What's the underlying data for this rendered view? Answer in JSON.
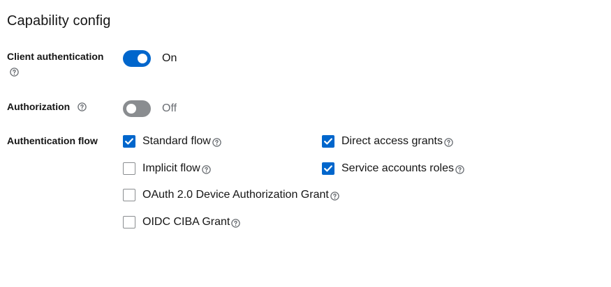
{
  "section": {
    "title": "Capability config"
  },
  "client_authentication": {
    "label": "Client authentication",
    "state": "On",
    "enabled": true
  },
  "authorization": {
    "label": "Authorization",
    "state": "Off",
    "enabled": false
  },
  "authentication_flow": {
    "label": "Authentication flow",
    "options": [
      {
        "label": "Standard flow",
        "checked": true
      },
      {
        "label": "Direct access grants",
        "checked": true
      },
      {
        "label": "Implicit flow",
        "checked": false
      },
      {
        "label": "Service accounts roles",
        "checked": true
      },
      {
        "label": "OAuth 2.0 Device Authorization Grant",
        "checked": false
      },
      {
        "label": "OIDC CIBA Grant",
        "checked": false
      }
    ]
  },
  "colors": {
    "accent": "#0066cc",
    "switch_off": "#8a8d90",
    "text": "#151515",
    "muted": "#6a6e73"
  },
  "icons": {
    "help": "question-circle-icon",
    "check": "checkmark-icon"
  }
}
